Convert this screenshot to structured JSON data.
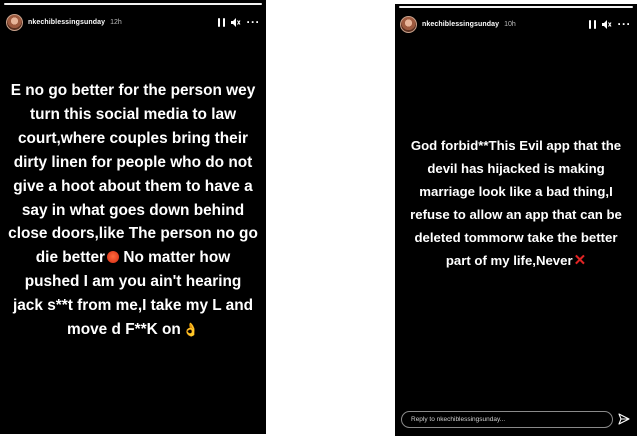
{
  "left_story": {
    "username": "nkechiblessingsunday",
    "time_ago": "12h",
    "icons": [
      "pause-icon",
      "speaker-icon",
      "more-icon"
    ],
    "text_part1": "E no go better for the person wey turn this social media to law court,where couples bring their dirty linen for people who do not give a hoot about them to have a say in what goes down behind close doors,like The person no go die better",
    "text_part2": " No matter how pushed I am you ain't hearing jack ",
    "text_censored_1": "s**t",
    "text_part3": " from me,I take my L and move d ",
    "text_censored_2": "F**K",
    "text_part4": " on"
  },
  "right_story": {
    "username": "nkechiblessingsunday",
    "time_ago": "10h",
    "icons": [
      "pause-icon",
      "speaker-icon",
      "more-icon"
    ],
    "text": "God forbid**This Evil app that the devil has hijacked is making marriage look like a  bad thing,I refuse to allow an app that can be deleted tommorw take the better part of my life,Never",
    "reply_placeholder": "Reply to nkechiblessingsunday..."
  },
  "colors": {
    "story_background": "#000000",
    "text": "#ffffff",
    "red_x": "#e02424"
  }
}
